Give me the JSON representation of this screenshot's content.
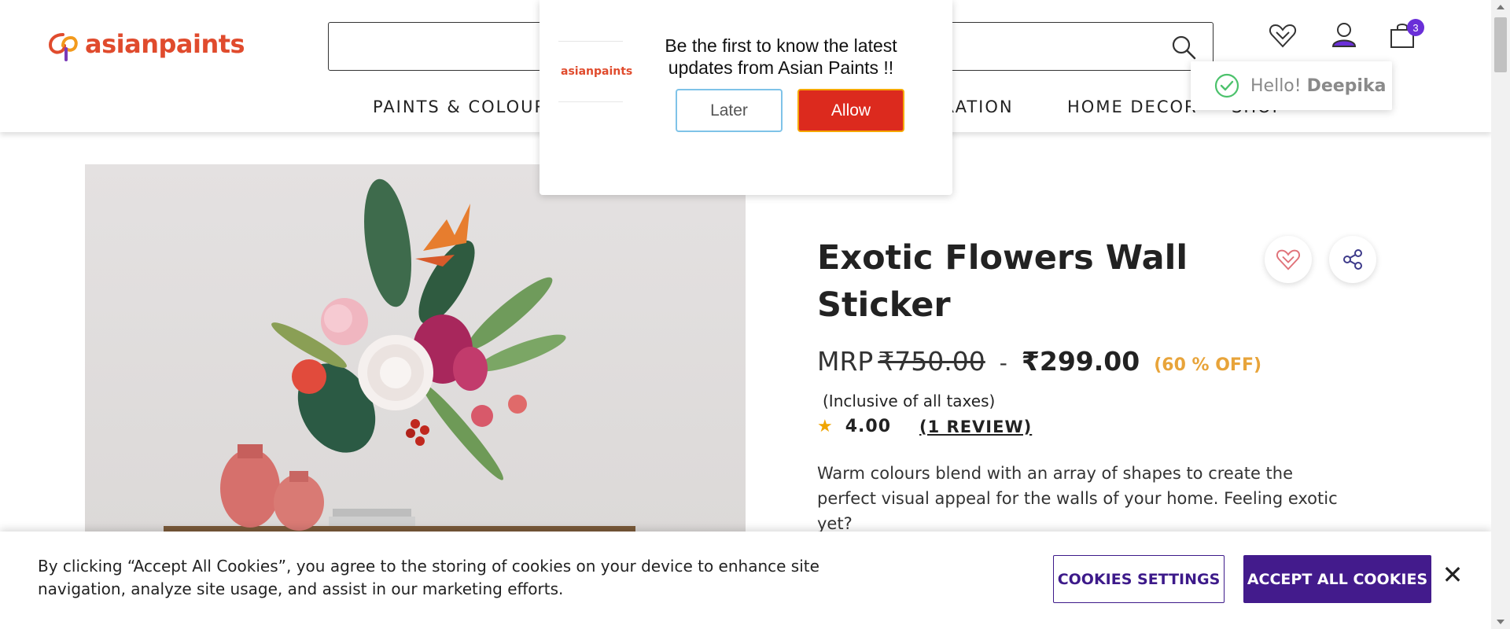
{
  "brand": {
    "name": "asianpaints",
    "color": "#e04b2d"
  },
  "header": {
    "search": {
      "placeholder": ""
    },
    "cart_count": "3",
    "icons": [
      "heart-icon",
      "user-icon",
      "bag-icon",
      "search-icon"
    ]
  },
  "user_tooltip": {
    "greeting": "Hello! ",
    "name": "Deepika"
  },
  "nav": {
    "items": [
      "PAINTS & COLOUR",
      "PIRATION",
      "HOME DECOR",
      "SHOP"
    ]
  },
  "notification": {
    "message": "Be the first to know the latest updates from Asian Paints !!",
    "later_label": "Later",
    "allow_label": "Allow"
  },
  "product": {
    "title": "Exotic Flowers Wall Sticker",
    "mrp_label": "MRP",
    "mrp_value": "₹750.00",
    "separator": "-",
    "price": "₹299.00",
    "discount": "(60 % OFF)",
    "taxes": "(Inclusive of all taxes)",
    "rating": "4.00",
    "reviews": "(1 REVIEW)",
    "description": "Warm colours blend with an array of shapes to create the perfect visual appeal for the walls of your home. Feeling exotic yet?"
  },
  "cookie_banner": {
    "text": "By clicking “Accept All Cookies”, you agree to the storing of cookies on your device to enhance site navigation, analyze site usage, and assist in our marketing efforts.",
    "settings_label": "COOKIES SETTINGS",
    "accept_label": "ACCEPT ALL COOKIES",
    "close_label": "✕"
  },
  "colors": {
    "accent_purple": "#431b8c",
    "allow_red": "#dc2a1e",
    "discount_orange": "#e8a43a",
    "badge_purple": "#6a2fd8"
  }
}
